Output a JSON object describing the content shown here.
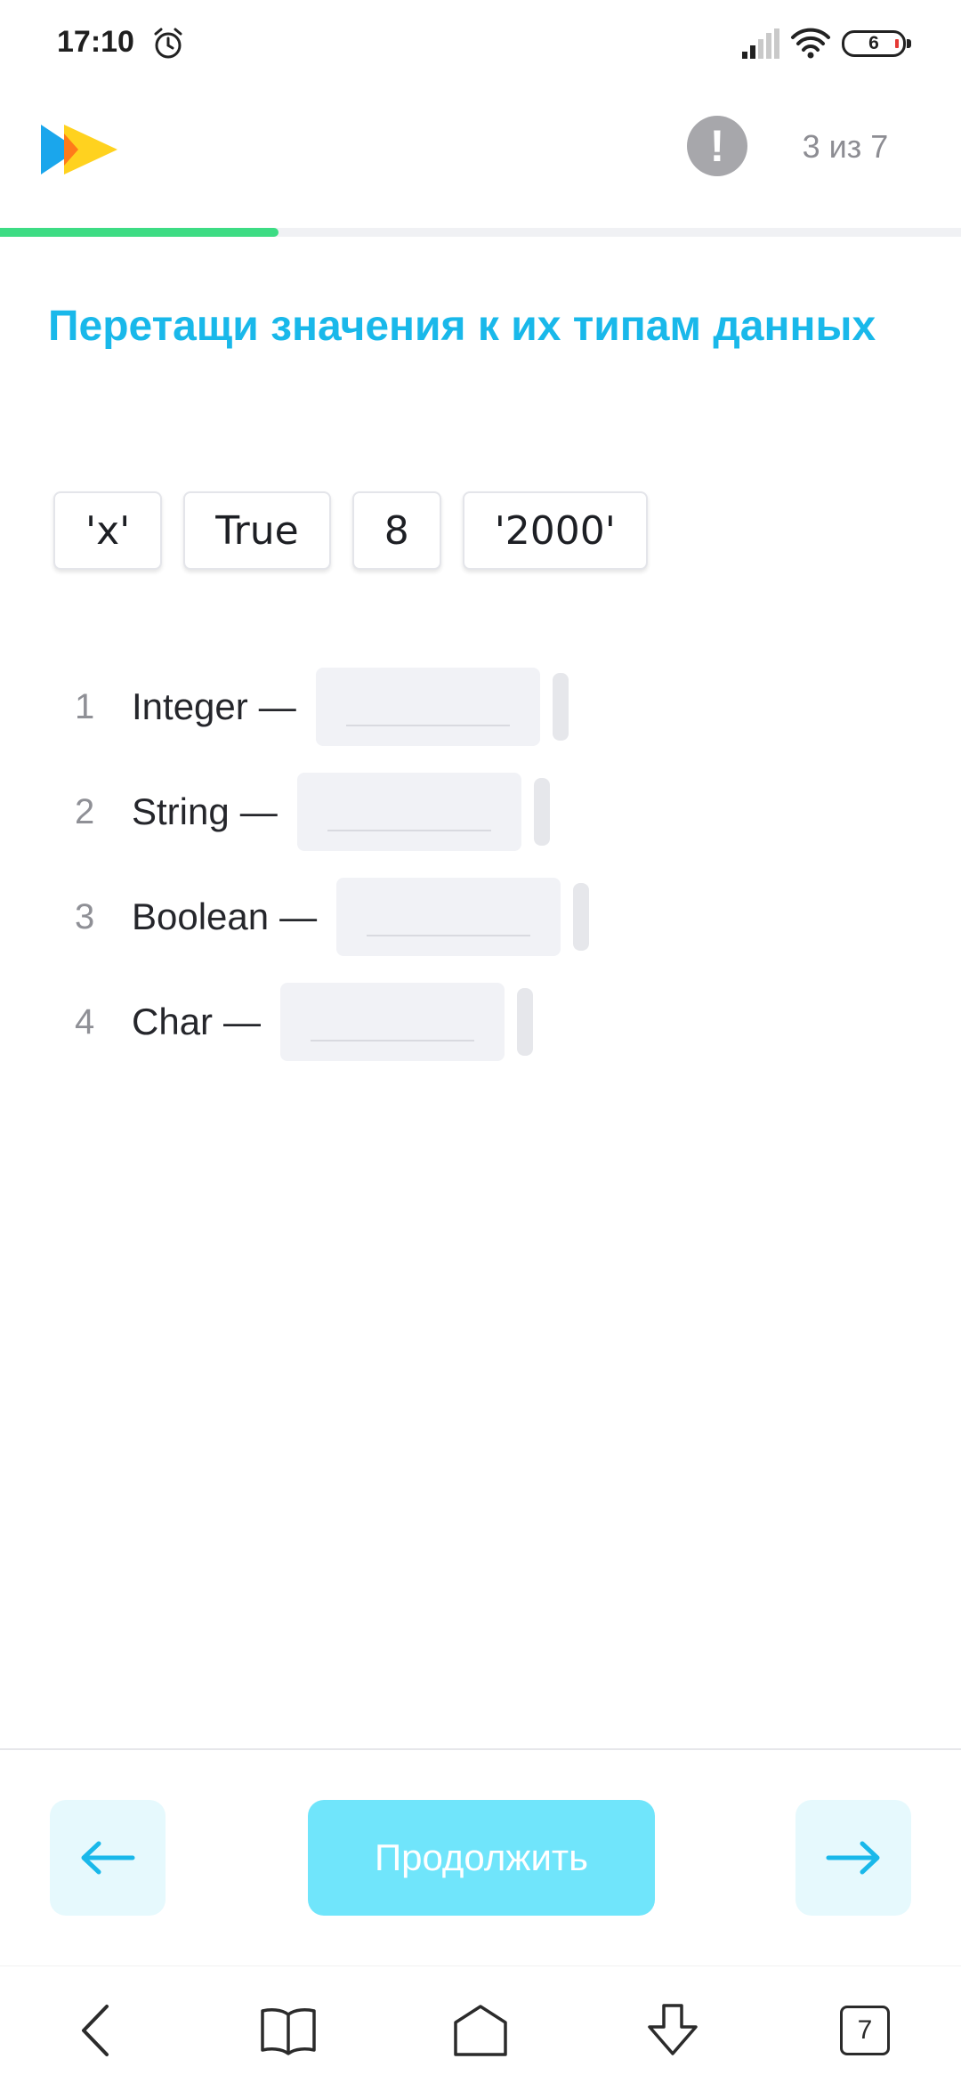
{
  "status_bar": {
    "time": "17:10",
    "battery_level": "6",
    "icons": [
      "alarm-icon",
      "signal-icon",
      "wifi-icon",
      "battery-icon"
    ]
  },
  "header": {
    "report_icon_glyph": "!",
    "progress_counter": "3 из 7",
    "progress_fraction": 0.29,
    "progress_color": "#3ddc84"
  },
  "task": {
    "title": "Перетащи значения к их типам данных",
    "title_color": "#19b8ea",
    "options": [
      "'x'",
      "True",
      "8",
      "'2000'"
    ],
    "questions": [
      {
        "number": "1",
        "label": "Integer"
      },
      {
        "number": "2",
        "label": "String"
      },
      {
        "number": "3",
        "label": "Boolean"
      },
      {
        "number": "4",
        "label": "Char"
      }
    ],
    "dash": "—"
  },
  "actions": {
    "back_icon": "arrow-left-icon",
    "continue_label": "Продолжить",
    "next_icon": "arrow-right-icon",
    "accent_color": "#19b8ea"
  },
  "system_nav": {
    "tabs_count": "7",
    "icons": [
      "back-chevron-icon",
      "book-icon",
      "home-icon",
      "download-icon",
      "tabs-icon"
    ]
  }
}
